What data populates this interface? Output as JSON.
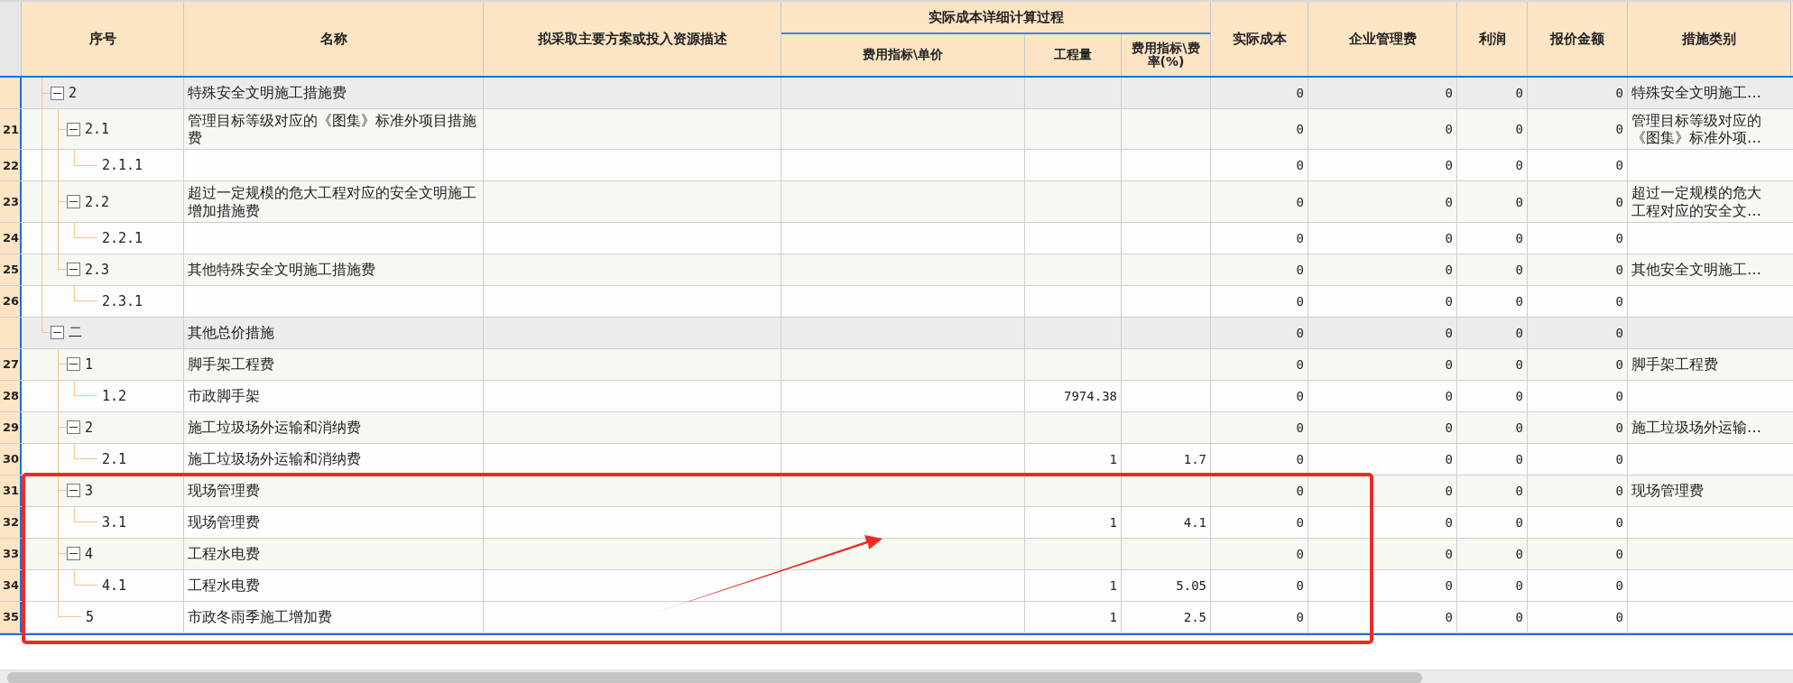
{
  "columns": [
    {
      "label": "序号"
    },
    {
      "label": "名称"
    },
    {
      "label": "拟采取主要方案或投入资源描述"
    },
    {
      "label": "实际成本详细计算过程",
      "children": [
        {
          "label": "费用指标\\单价"
        },
        {
          "label": "工程量"
        },
        {
          "label": "费用指标\\费率(%)"
        }
      ]
    },
    {
      "label": "实际成本"
    },
    {
      "label": "企业管理费"
    },
    {
      "label": "利润"
    },
    {
      "label": "报价金额"
    },
    {
      "label": "措施类别"
    }
  ],
  "rows": [
    {
      "seq": "2",
      "name": "特殊安全文明施工措施费",
      "kind": "group",
      "expanded": true,
      "actual_cost": "0",
      "mgmt_fee": "0",
      "profit": "0",
      "quote": "0",
      "category": "特殊安全文明施工…",
      "children": [
        {
          "row_no": "21",
          "seq": "2.1",
          "name": "管理目标等级对应的《图集》标准外项目措施费",
          "kind": "subgroup",
          "expanded": true,
          "actual_cost": "0",
          "mgmt_fee": "0",
          "profit": "0",
          "quote": "0",
          "category": "管理目标等级对应的《图集》标准外项…",
          "children": [
            {
              "row_no": "22",
              "seq": "2.1.1",
              "kind": "leaf",
              "actual_cost": "0",
              "mgmt_fee": "0",
              "profit": "0",
              "quote": "0"
            }
          ]
        },
        {
          "row_no": "23",
          "seq": "2.2",
          "name": "超过一定规模的危大工程对应的安全文明施工增加措施费",
          "kind": "subgroup",
          "expanded": true,
          "actual_cost": "0",
          "mgmt_fee": "0",
          "profit": "0",
          "quote": "0",
          "category": "超过一定规模的危大工程对应的安全文…",
          "children": [
            {
              "row_no": "24",
              "seq": "2.2.1",
              "kind": "leaf",
              "actual_cost": "0",
              "mgmt_fee": "0",
              "profit": "0",
              "quote": "0"
            }
          ]
        },
        {
          "row_no": "25",
          "seq": "2.3",
          "name": "其他特殊安全文明施工措施费",
          "kind": "subgroup",
          "expanded": true,
          "actual_cost": "0",
          "mgmt_fee": "0",
          "profit": "0",
          "quote": "0",
          "category": "其他安全文明施工…",
          "children": [
            {
              "row_no": "26",
              "seq": "2.3.1",
              "kind": "leaf",
              "actual_cost": "0",
              "mgmt_fee": "0",
              "profit": "0",
              "quote": "0"
            }
          ]
        }
      ]
    },
    {
      "seq": "二",
      "name": "其他总价措施",
      "kind": "group",
      "expanded": true,
      "actual_cost": "0",
      "mgmt_fee": "0",
      "profit": "0",
      "quote": "0",
      "children": [
        {
          "row_no": "27",
          "seq": "1",
          "name": "脚手架工程费",
          "kind": "subgroup",
          "expanded": true,
          "actual_cost": "0",
          "mgmt_fee": "0",
          "profit": "0",
          "quote": "0",
          "category": "脚手架工程费",
          "children": [
            {
              "row_no": "28",
              "seq": "1.2",
              "name": "市政脚手架",
              "kind": "leaf",
              "quantity": "7974.38",
              "actual_cost": "0",
              "mgmt_fee": "0",
              "profit": "0",
              "quote": "0"
            }
          ]
        },
        {
          "row_no": "29",
          "seq": "2",
          "name": "施工垃圾场外运输和消纳费",
          "kind": "subgroup",
          "expanded": true,
          "actual_cost": "0",
          "mgmt_fee": "0",
          "profit": "0",
          "quote": "0",
          "category": "施工垃圾场外运输…",
          "children": [
            {
              "row_no": "30",
              "seq": "2.1",
              "name": "施工垃圾场外运输和消纳费",
              "kind": "leaf",
              "quantity": "1",
              "rate": "1.7",
              "actual_cost": "0",
              "mgmt_fee": "0",
              "profit": "0",
              "quote": "0"
            }
          ]
        },
        {
          "row_no": "31",
          "seq": "3",
          "name": "现场管理费",
          "kind": "subgroup",
          "expanded": true,
          "actual_cost": "0",
          "mgmt_fee": "0",
          "profit": "0",
          "quote": "0",
          "category": "现场管理费",
          "children": [
            {
              "row_no": "32",
              "seq": "3.1",
              "name": "现场管理费",
              "kind": "leaf",
              "quantity": "1",
              "rate": "4.1",
              "actual_cost": "0",
              "mgmt_fee": "0",
              "profit": "0",
              "quote": "0"
            }
          ]
        },
        {
          "row_no": "33",
          "seq": "4",
          "name": "工程水电费",
          "kind": "subgroup",
          "expanded": true,
          "actual_cost": "0",
          "mgmt_fee": "0",
          "profit": "0",
          "quote": "0",
          "children": [
            {
              "row_no": "34",
              "seq": "4.1",
              "name": "工程水电费",
              "kind": "leaf",
              "quantity": "1",
              "rate": "5.05",
              "actual_cost": "0",
              "mgmt_fee": "0",
              "profit": "0",
              "quote": "0"
            }
          ]
        },
        {
          "row_no": "35",
          "seq": "5",
          "name": "市政冬雨季施工增加费",
          "kind": "leaf",
          "quantity": "1",
          "rate": "2.5",
          "actual_cost": "0",
          "mgmt_fee": "0",
          "profit": "0",
          "quote": "0"
        }
      ]
    }
  ],
  "annotations": {
    "frame": true,
    "arrow": true
  }
}
